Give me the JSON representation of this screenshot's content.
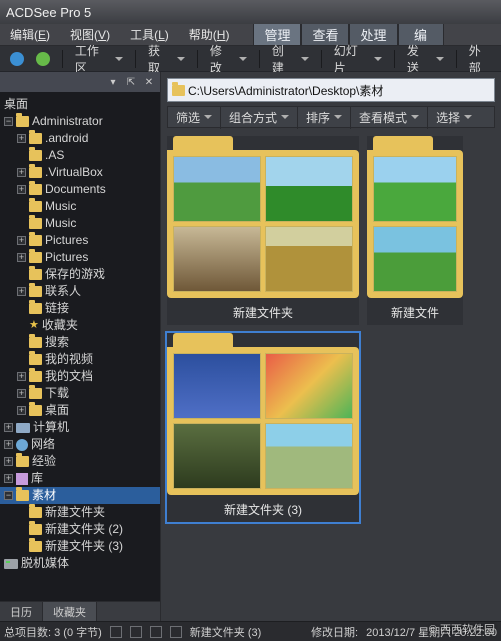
{
  "app": {
    "title": "ACDSee Pro 5"
  },
  "menu": {
    "edit": {
      "label": "编辑",
      "key": "E"
    },
    "view": {
      "label": "视图",
      "key": "V"
    },
    "tools": {
      "label": "工具",
      "key": "L"
    },
    "help": {
      "label": "帮助",
      "key": "H"
    },
    "tabs": {
      "manage": "管理",
      "view2": "查看",
      "process": "处理",
      "edit2": "编"
    }
  },
  "toolbar": {
    "workspace": "工作区",
    "import": "获取",
    "batch": "修改",
    "create": "创建",
    "slideshow": "幻灯片",
    "send": "发送",
    "external": "外部"
  },
  "sidebar": {
    "desktop_root": "桌面",
    "user": "Administrator",
    "folders": {
      "android": ".android",
      "as": ".AS",
      "vbox": ".VirtualBox",
      "documents": "Documents",
      "music1": "Music",
      "music2": "Music",
      "pictures1": "Pictures",
      "pictures2": "Pictures",
      "savedgames": "保存的游戏",
      "contacts": "联系人",
      "links": "链接",
      "favorites": "收藏夹",
      "search": "搜索",
      "videos": "我的视频",
      "mydocs": "我的文档",
      "downloads": "下载",
      "desktop2": "桌面"
    },
    "computer": "计算机",
    "network": "网络",
    "experience": "经验",
    "library": "库",
    "material": "素材",
    "newfolder1": "新建文件夹",
    "newfolder2": "新建文件夹 (2)",
    "newfolder3": "新建文件夹 (3)",
    "offline": "脱机媒体",
    "bottom_tabs": {
      "calendar": "日历",
      "favorites": "收藏夹"
    }
  },
  "pathbar": {
    "path": "C:\\Users\\Administrator\\Desktop\\素材"
  },
  "filterbar": {
    "filter": "筛选",
    "group": "组合方式",
    "sort": "排序",
    "view": "查看模式",
    "select": "选择"
  },
  "folders": {
    "f1": "新建文件夹",
    "f2": "新建文件",
    "f3": "新建文件夹 (3)"
  },
  "status": {
    "count_label": "总项目数: 3 (0 字节)",
    "selected_label": "新建文件夹 (3)",
    "modified_label": "修改日期:",
    "modified_value": "2013/12/7 星期六 20:22:30"
  },
  "watermark": "© 西西软件园"
}
